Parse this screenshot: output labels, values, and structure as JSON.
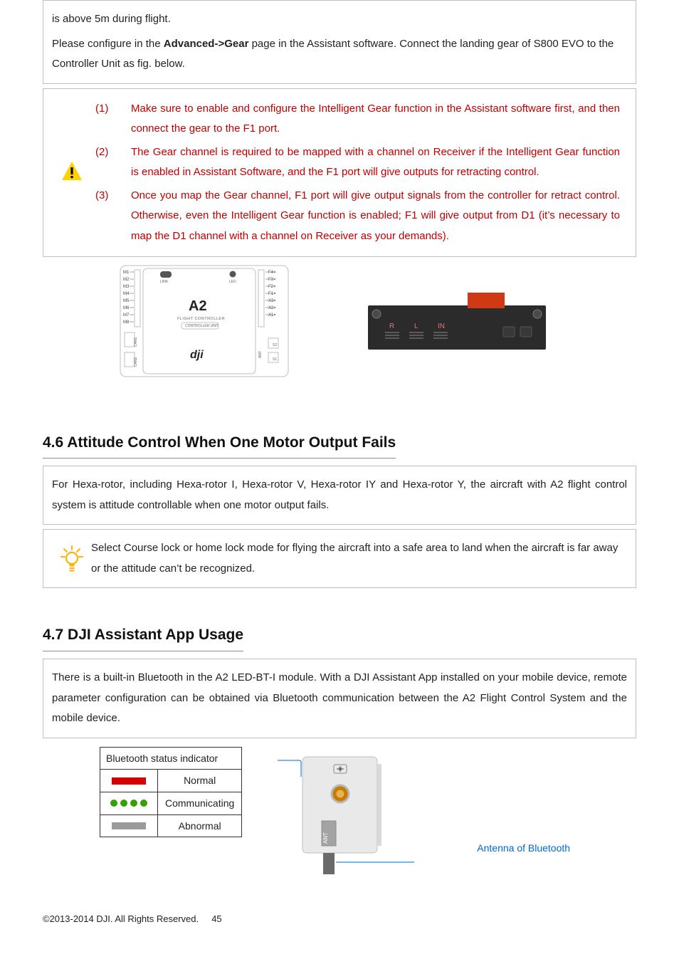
{
  "top_box": {
    "line1": "is above 5m during flight.",
    "line2_a": "Please configure in the ",
    "line2_b": "Advanced->Gear",
    "line2_c": " page in the Assistant software. Connect the landing gear of S800 EVO to the Controller Unit as fig. below."
  },
  "warnings": [
    {
      "num": "(1)",
      "text": "Make sure to enable and configure the Intelligent Gear function in the Assistant software first, and then connect the gear to the F1 port."
    },
    {
      "num": "(2)",
      "text": "The Gear channel is required to be mapped with a channel on Receiver if the Intelligent Gear function is enabled in Assistant Software, and the F1 port will give outputs for retracting control."
    },
    {
      "num": "(3)",
      "text": "Once you map the Gear channel, F1 port will give output signals from the controller for retract control. Otherwise, even the Intelligent Gear function is enabled; F1 will give output from D1 (it’s necessary to map the D1 channel with a channel on Receiver as your demands)."
    }
  ],
  "controller": {
    "brand": "A2",
    "sub1": "FLIGHT CONTROLLER",
    "sub2": "CONTROLLER UNIT",
    "logo": "dji",
    "left_ports": [
      "M1",
      "M2",
      "M3",
      "M4",
      "M5",
      "M6",
      "M7",
      "M8"
    ],
    "left_sub": [
      "CAN1",
      "CAN2"
    ],
    "top_labels": [
      "LINK",
      "LED"
    ],
    "right_ports": [
      "F4",
      "F3",
      "F2",
      "F1",
      "X3",
      "X2",
      "X1"
    ],
    "right_sub": [
      "S2",
      "S1"
    ],
    "ant": "ANT"
  },
  "gear_module": {
    "R": "R",
    "L": "L",
    "IN": "IN"
  },
  "section_46": {
    "title": "4.6 Attitude Control When One Motor Output Fails",
    "body": "For Hexa-rotor, including Hexa-rotor I, Hexa-rotor V, Hexa-rotor IY and Hexa-rotor Y, the aircraft with A2 flight control system is attitude controllable when one motor output fails.",
    "tip": "Select Course lock or home lock mode for flying the aircraft into a safe area to land when the aircraft is far away or the attitude can’t be recognized."
  },
  "section_47": {
    "title": "4.7 DJI Assistant App Usage",
    "body": "There is a built-in Bluetooth in the A2 LED-BT-I module. With a DJI Assistant App installed on your mobile device, remote parameter configuration can be obtained via Bluetooth communication between the A2 Flight Control System and the mobile device."
  },
  "bt_table": {
    "header": "Bluetooth status indicator",
    "rows": [
      {
        "indicator": "solid-red",
        "label": "Normal"
      },
      {
        "indicator": "green-dots",
        "label": "Communicating"
      },
      {
        "indicator": "solid-grey",
        "label": "Abnormal"
      }
    ]
  },
  "antenna_callout": "Antenna of Bluetooth",
  "module_ant_label": "ANT",
  "footer": {
    "copyright": "©2013-2014 DJI. All Rights Reserved.",
    "page": "45"
  }
}
